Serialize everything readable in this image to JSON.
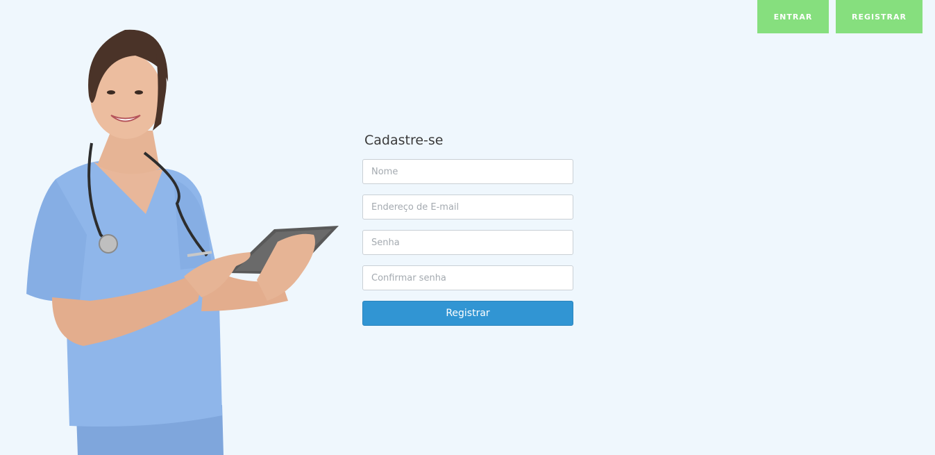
{
  "nav": {
    "login_label": "ENTRAR",
    "register_label": "REGISTRAR"
  },
  "form": {
    "title": "Cadastre-se",
    "fields": {
      "name_placeholder": "Nome",
      "email_placeholder": "Endereço de E-mail",
      "password_placeholder": "Senha",
      "confirm_password_placeholder": "Confirmar senha"
    },
    "submit_label": "Registrar"
  },
  "colors": {
    "background": "#eff7fd",
    "nav_button": "#86df7e",
    "primary_button": "#3195d3"
  }
}
